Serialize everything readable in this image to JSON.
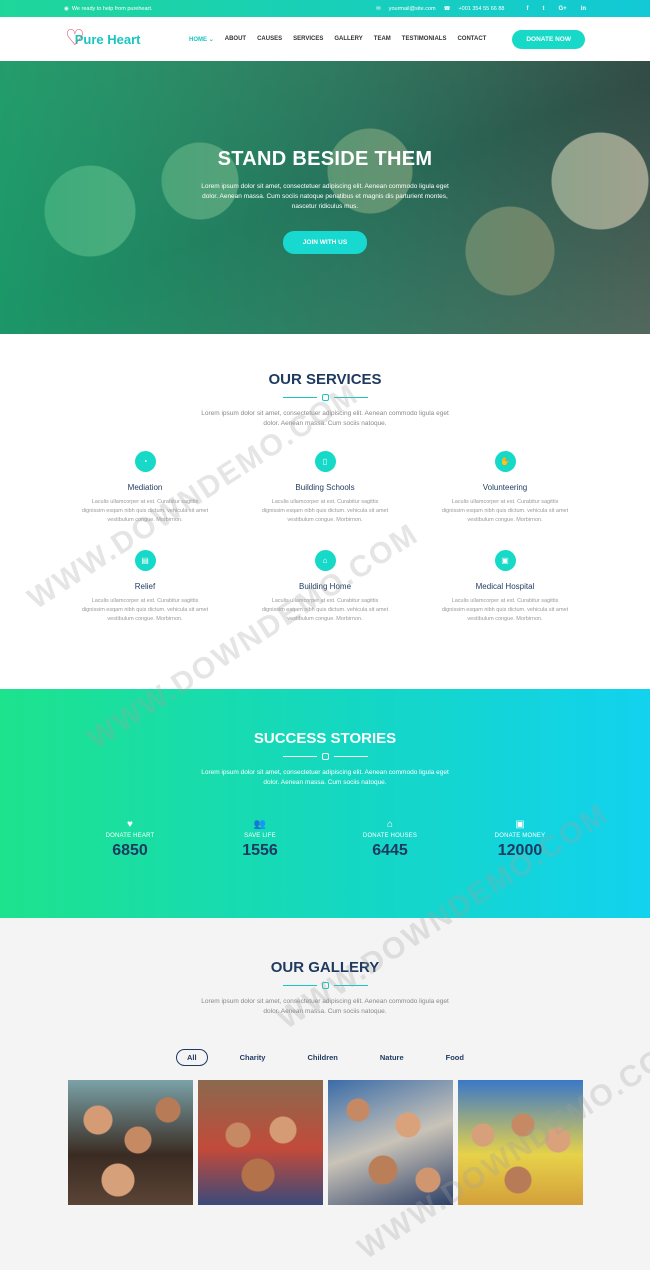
{
  "topbar": {
    "tagline": "We ready to help from pureheart.",
    "email": "yourmail@site.com",
    "phone": "+001 354 55 66 88",
    "social": [
      "f",
      "t",
      "G+",
      "in"
    ]
  },
  "nav": {
    "logo": "Pure Heart",
    "items": [
      "HOME",
      "ABOUT",
      "CAUSES",
      "SERVICES",
      "GALLERY",
      "TEAM",
      "TESTIMONIALS",
      "CONTACT"
    ],
    "cta": "DONATE NOW"
  },
  "hero": {
    "title": "STAND BESIDE THEM",
    "text": "Lorem ipsum dolor sit amet, consectetuer adipiscing elit. Aenean commodo ligula eget dolor. Aenean massa. Cum sociis natoque penatibus et magnis dis parturient montes, nascetur ridiculus mus.",
    "button": "JOIN WITH US"
  },
  "services": {
    "title": "OUR SERVICES",
    "desc": "Lorem ipsum dolor sit amet, consectetuer adipiscing elit. Aenean commodo ligula eget dolor. Aenean massa. Cum sociis natoque.",
    "items": [
      {
        "title": "Mediation",
        "icon": "mediation-icon",
        "text": "Laculis ullamcorper at est. Curabitur sagittis dignissim esqam nibh quis dictum. vehicula sit amet vestibulum congue. Morbirnon."
      },
      {
        "title": "Building Schools",
        "icon": "school-icon",
        "text": "Laculis ullamcorper at est. Curabitur sagittis dignissim esqam nibh quis dictum. vehicula sit amet vestibulum congue. Morbirnon."
      },
      {
        "title": "Volunteering",
        "icon": "volunteer-icon",
        "text": "Laculis ullamcorper at est. Curabitur sagittis dignissim esqam nibh quis dictum. vehicula sit amet vestibulum congue. Morbirnon."
      },
      {
        "title": "Relief",
        "icon": "relief-icon",
        "text": "Laculis ullamcorper at est. Curabitur sagittis dignissim esqam nibh quis dictum. vehicula sit amet vestibulum congue. Morbirnon."
      },
      {
        "title": "Building Home",
        "icon": "home-icon",
        "text": "Laculis ullamcorper at est. Curabitur sagittis dignissim esqam nibh quis dictum. vehicula sit amet vestibulum congue. Morbirnon."
      },
      {
        "title": "Medical Hospital",
        "icon": "hospital-icon",
        "text": "Laculis ullamcorper at est. Curabitur sagittis dignissim esqam nibh quis dictum. vehicula sit amet vestibulum congue. Morbirnon."
      }
    ]
  },
  "success": {
    "title": "SUCCESS STORIES",
    "desc": "Lorem ipsum dolor sit amet, consectetuer adipiscing elit. Aenean commodo ligula eget dolor. Aenean massa. Cum sociis natoque.",
    "stats": [
      {
        "label": "DONATE HEART",
        "value": "6850",
        "icon": "heart-icon"
      },
      {
        "label": "SAVE LIFE",
        "value": "1556",
        "icon": "people-icon"
      },
      {
        "label": "DONATE HOUSES",
        "value": "6445",
        "icon": "house-icon"
      },
      {
        "label": "DONATE MONEY",
        "value": "12000",
        "icon": "money-icon"
      }
    ]
  },
  "gallery": {
    "title": "OUR GALLERY",
    "desc": "Lorem ipsum dolor sit amet, consectetuer adipiscing elit. Aenean commodo ligula eget dolor. Aenean massa. Cum sociis natoque.",
    "filters": [
      "All",
      "Charity",
      "Children",
      "Nature",
      "Food"
    ]
  },
  "watermark": "WWW.DOWNDEMO.COM",
  "colors": {
    "accent": "#17d9c7",
    "navy": "#1e3a5f",
    "brand_green": "#1de38d",
    "heart": "#e84c6a"
  }
}
